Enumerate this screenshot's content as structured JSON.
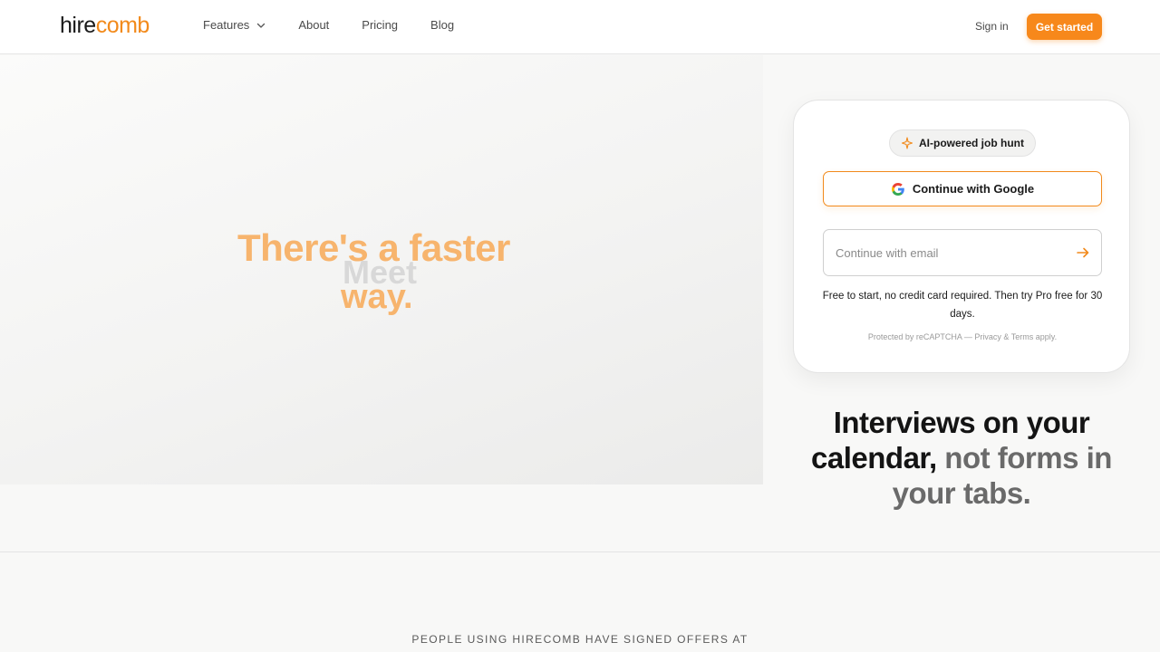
{
  "header": {
    "logo_prefix": "hire",
    "logo_suffix": "comb",
    "nav": [
      {
        "label": "Features",
        "has_dropdown": true
      },
      {
        "label": "About"
      },
      {
        "label": "Pricing"
      },
      {
        "label": "Blog"
      }
    ],
    "signin_label": "Sign in",
    "cta_label": "Get started"
  },
  "hero": {
    "line1": "There's a faster",
    "line_meet": "Meet",
    "line_way": "way."
  },
  "signup_card": {
    "badge": "AI-powered job hunt",
    "google_label": "Continue with Google",
    "email_placeholder": "Continue with email",
    "email_value": "",
    "free_text": "Free to start, no credit card required. Then try Pro free for 30 days.",
    "recaptcha_text": "Protected by reCAPTCHA — Privacy & Terms apply."
  },
  "tagline": {
    "part1": "Interviews on your calendar,",
    "part2": "not forms in your tabs."
  },
  "offers_heading": "PEOPLE USING HIRECOMB HAVE SIGNED OFFERS AT",
  "colors": {
    "accent": "#f7881b",
    "hero_text": "#f7b46d",
    "muted": "#6a6a6a"
  },
  "icons": {
    "features_dropdown": "chevron-down-icon",
    "badge": "sparkle-icon",
    "google": "google-icon",
    "email_submit": "arrow-right-icon"
  }
}
